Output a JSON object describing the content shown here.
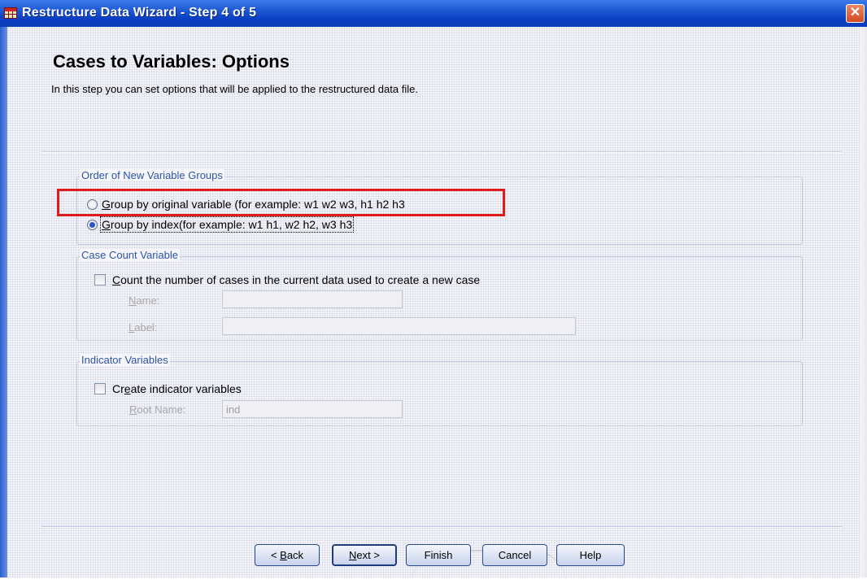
{
  "window": {
    "title": "Restructure Data Wizard - Step 4 of 5",
    "close_glyph": "✕"
  },
  "page": {
    "heading": "Cases to Variables: Options",
    "description": "In this step you can set options that will be applied to the restructured data file."
  },
  "order_group": {
    "legend": "Order of New Variable Groups",
    "options": [
      {
        "accesskey": "G",
        "rest": "roup by original variable (for example: w1 w2 w3, h1 h2 h3",
        "checked": false
      },
      {
        "accesskey": "G",
        "rest": "roup by index(for example: w1 h1, w2 h2, w3 h3",
        "checked": true
      }
    ]
  },
  "case_count_group": {
    "legend": "Case Count Variable",
    "checkbox_accesskey": "C",
    "checkbox_rest": "ount the number of cases in the current data used to create a new case",
    "checked": false,
    "name_label_key": "N",
    "name_label_rest": "ame:",
    "name_value": "",
    "label_label_key": "L",
    "label_label_rest": "abel:",
    "label_value": ""
  },
  "indicator_group": {
    "legend": "Indicator Variables",
    "checkbox_pre": "Cr",
    "checkbox_accesskey": "e",
    "checkbox_rest": "ate indicator variables",
    "checked": false,
    "root_label_key": "R",
    "root_label_rest": "oot Name:",
    "root_value": "ind"
  },
  "buttons": {
    "back_prefix": "< ",
    "back_key": "B",
    "back_rest": "ack",
    "next_key": "N",
    "next_rest": "ext >",
    "finish": "Finish",
    "cancel": "Cancel",
    "help": "Help"
  },
  "colors": {
    "titlebar": "#0a3fc4",
    "legend_text": "#2c54a8",
    "highlight": "#e01b1b"
  }
}
